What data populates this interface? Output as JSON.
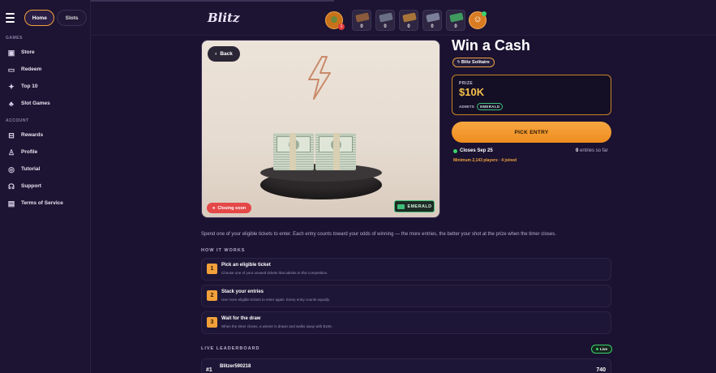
{
  "sidebar": {
    "home_label": "Home",
    "slots_label": "Slots",
    "games_section": "GAMES",
    "account_section": "ACCOUNT",
    "games_items": [
      {
        "label": "Store",
        "icon": "store-icon"
      },
      {
        "label": "Redeem",
        "icon": "redeem-icon"
      },
      {
        "label": "Top 10",
        "icon": "top10-icon"
      },
      {
        "label": "Slot Games",
        "icon": "slot-games-icon"
      }
    ],
    "account_items": [
      {
        "label": "Rewards",
        "icon": "rewards-icon"
      },
      {
        "label": "Profile",
        "icon": "profile-icon"
      },
      {
        "label": "Tutorial",
        "icon": "tutorial-icon"
      },
      {
        "label": "Support",
        "icon": "support-icon"
      },
      {
        "label": "Terms of Service",
        "icon": "terms-icon"
      }
    ]
  },
  "topbar": {
    "logo": "Blitz",
    "coin_badge": "1",
    "tickets": [
      {
        "count": "0",
        "color": "#8a5a3c"
      },
      {
        "count": "0",
        "color": "#6a6f86"
      },
      {
        "count": "0",
        "color": "#a9743a"
      },
      {
        "count": "0",
        "color": "#7c7f99"
      },
      {
        "count": "0",
        "color": "#3f9a5f"
      }
    ]
  },
  "hero": {
    "back_label": "Back",
    "closing_label": "Closing soon",
    "tier_label": "EMERALD"
  },
  "details": {
    "title": "Win a Cash",
    "game_chip": "Blitz Solitaire",
    "prize_label": "PRIZE",
    "prize_value": "$10K",
    "admits_label": "ADMITS",
    "admits_tier": "EMERALD",
    "pick_label": "PICK ENTRY",
    "closes_label": "Closes Sep 25",
    "entries_count": "0",
    "entries_suffix": " entries so far",
    "minimum": "Minimum 2,143 players · 4 joined"
  },
  "main": {
    "description": "Spend one of your eligible tickets to enter. Each entry counts toward your odds of winning — the more entries, the better your shot at the prize when the timer closes.",
    "how_heading": "HOW IT WORKS",
    "steps": [
      {
        "num": "1",
        "title": "Pick an eligible ticket",
        "subtitle": "Choose one of your unused tickets that admits to this competition."
      },
      {
        "num": "2",
        "title": "Stack your entries",
        "subtitle": "Use more eligible tickets to enter again. Every entry counts equally."
      },
      {
        "num": "3",
        "title": "Wait for the draw",
        "subtitle": "When the timer closes, a winner is drawn and walks away with $10K."
      }
    ],
    "leaderboard_heading": "LIVE LEADERBOARD",
    "live_label": "Live",
    "leaderboard": [
      {
        "rank": "#1",
        "name": "Blitzer590218",
        "score": "740"
      }
    ]
  },
  "colors": {
    "accent": "#f2a03a",
    "background": "#1a1230",
    "emerald": "#3fbf7a"
  }
}
